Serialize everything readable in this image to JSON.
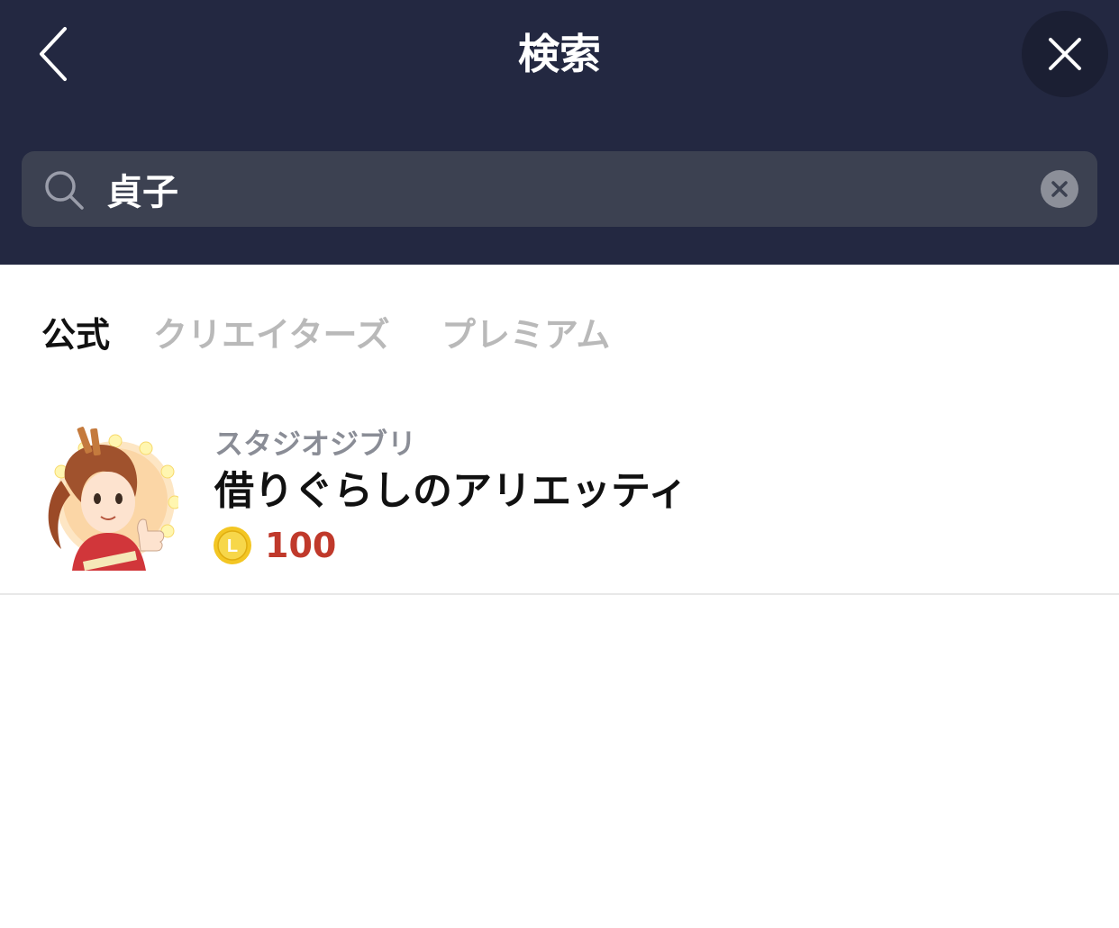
{
  "header": {
    "title": "検索",
    "back_icon": "chevron-left-icon",
    "close_icon": "close-icon",
    "background": "#232841"
  },
  "search": {
    "value": "貞子",
    "icon": "search-icon",
    "clear_icon": "clear-icon",
    "background": "#3c4151"
  },
  "tabs": [
    {
      "label": "公式",
      "active": true
    },
    {
      "label": "クリエイターズ",
      "active": false
    },
    {
      "label": "プレミアム",
      "active": false
    }
  ],
  "results": [
    {
      "author": "スタジオジブリ",
      "title": "借りぐらしのアリエッティ",
      "coin_icon": "line-coin-icon",
      "coin_letter": "L",
      "price": "100",
      "price_color": "#c0392b"
    }
  ]
}
